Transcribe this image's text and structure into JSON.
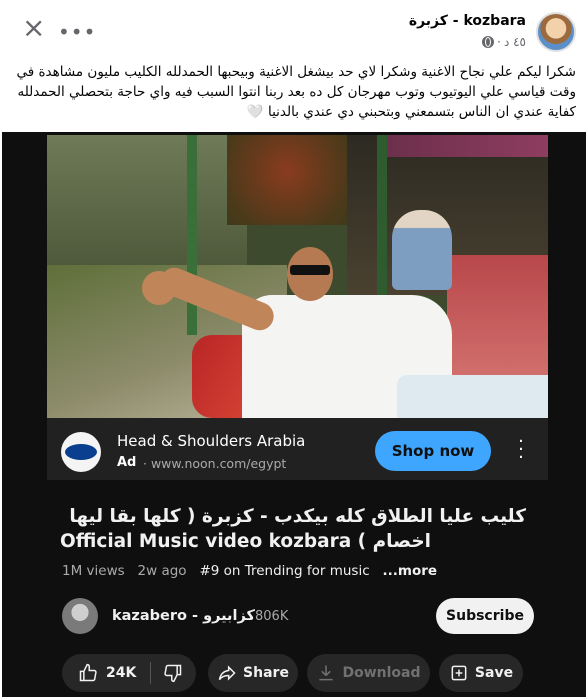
{
  "post": {
    "author": "kozbara - كزبرة",
    "time": "٤٥ د",
    "text": "شكرا ليكم علي نجاح الاغنية وشكرا لاي حد بيشغل الاغنية وبيحبها الحمدلله الكليب مليون مشاهدة في وقت قياسي علي اليوتيوب وتوب مهرجان كل ده بعد ربنا انتوا السبب فيه واي حاجة بتحصلي الحمدلله كفاية عندي ان الناس بتسمعني وبتحبني دي عندي بالدنيا 🤍"
  },
  "ad": {
    "advertiser": "Head & Shoulders Arabia",
    "badge": "Ad",
    "url": "www.noon.com/egypt",
    "cta": "Shop now"
  },
  "video": {
    "title_line1": "كليب عليا الطلاق كله بيكدب - كزبرة  ( كلها بقا ليها",
    "title_line2": "Official Music video kozbara  ( اخصام",
    "views": "1M views",
    "age": "2w ago",
    "trending": "#9 on Trending for music",
    "more": "...more"
  },
  "channel": {
    "name": "kazabero - كزابيرو",
    "subscribers": "806K",
    "subscribe_label": "Subscribe"
  },
  "actions": {
    "likes": "24K",
    "share": "Share",
    "download": "Download",
    "save": "Save"
  },
  "icons": {
    "close": "close-icon",
    "more": "more-horizontal-icon",
    "globe": "globe-icon",
    "like": "thumbs-up-icon",
    "dislike": "thumbs-down-icon",
    "share": "share-arrow-icon",
    "download": "download-icon",
    "save": "save-playlist-icon",
    "ad_menu": "more-vertical-icon"
  },
  "colors": {
    "youtube_bg": "#0f0f0f",
    "shop_button": "#3ea6ff",
    "pill_bg": "#272727"
  }
}
